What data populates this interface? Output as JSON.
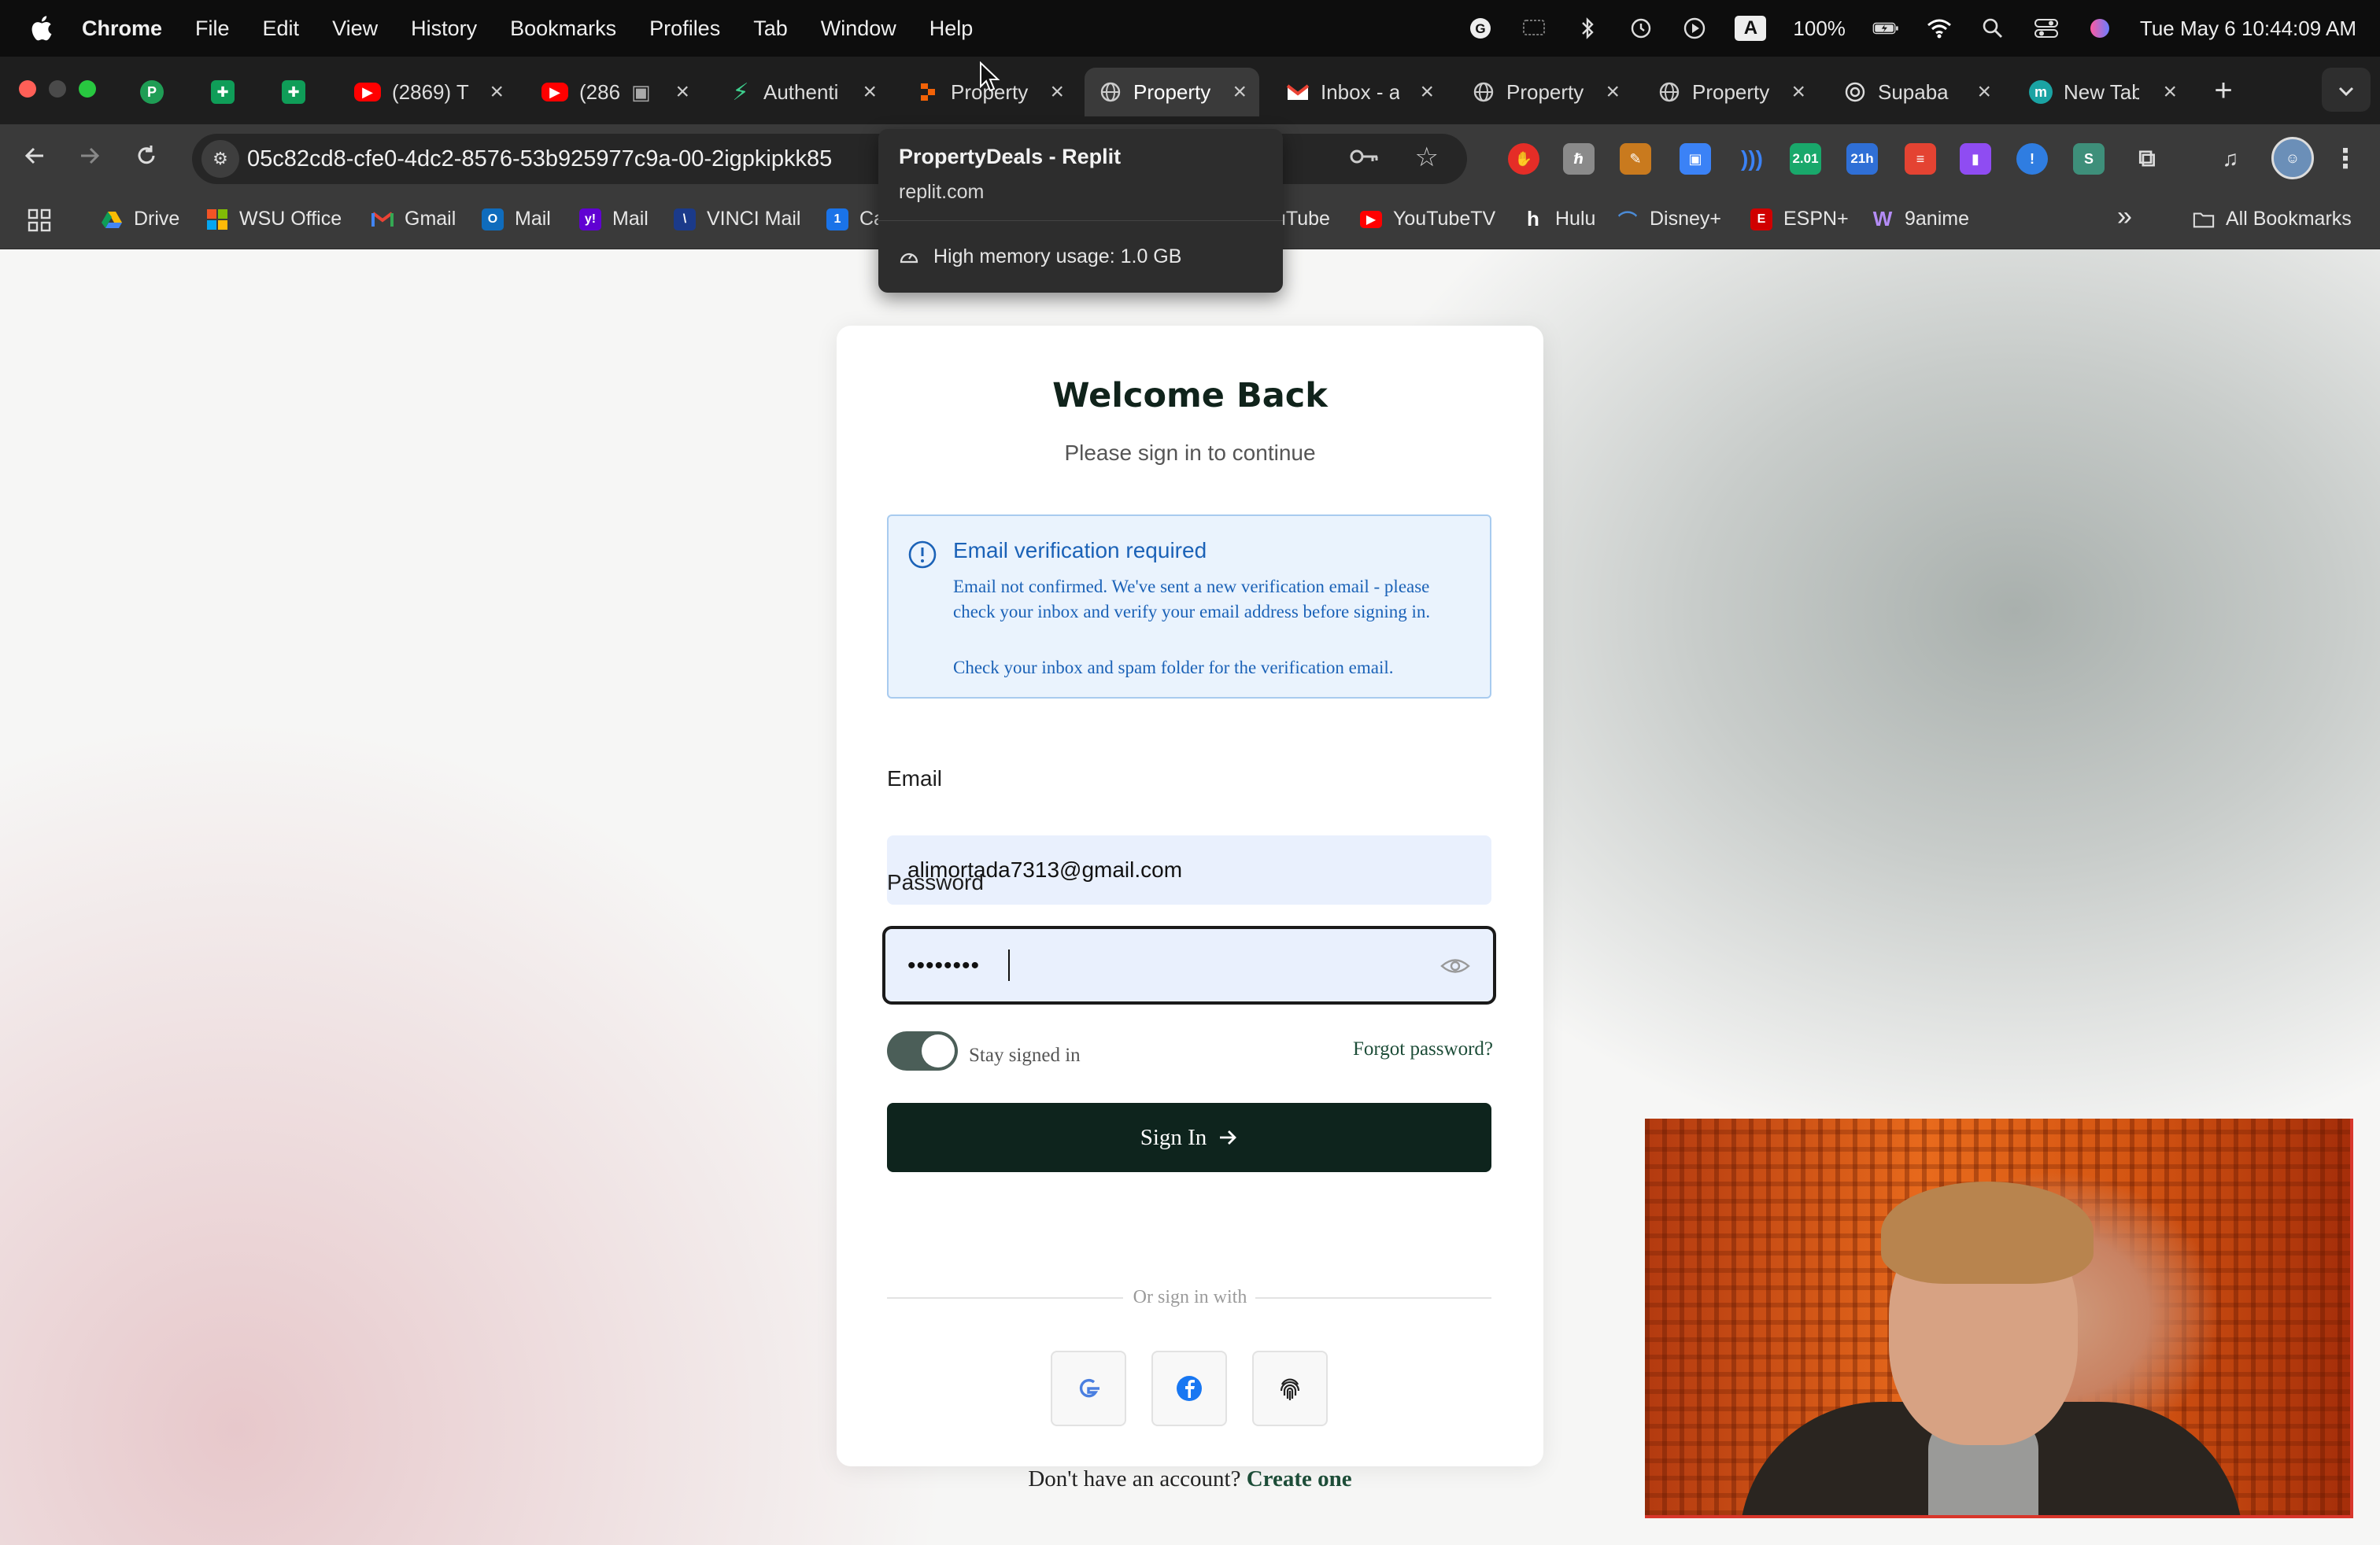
{
  "menubar": {
    "app": "Chrome",
    "menus": [
      "File",
      "Edit",
      "View",
      "History",
      "Bookmarks",
      "Profiles",
      "Tab",
      "Window",
      "Help"
    ],
    "battery": "100%",
    "datetime": "Tue May 6  10:44:09 AM",
    "input_source": "A"
  },
  "tabs": [
    {
      "title": "",
      "icon": "p-green-icon",
      "color": "#1f9d55"
    },
    {
      "title": "",
      "icon": "sheets-icon",
      "color": "#0f9d58"
    },
    {
      "title": "",
      "icon": "sheets-icon",
      "color": "#0f9d58"
    },
    {
      "title": "(2869) T",
      "icon": "youtube-icon",
      "color": "#ff0000"
    },
    {
      "title": "(286",
      "icon": "youtube-icon",
      "color": "#ff0000"
    },
    {
      "title": "Authenti",
      "icon": "supabase-icon",
      "color": "#3ecf8e"
    },
    {
      "title": "Property",
      "icon": "replit-icon",
      "color": "#f26207"
    },
    {
      "title": "Property",
      "icon": "globe-icon",
      "color": "#9aa0a6"
    },
    {
      "title": "Inbox - a",
      "icon": "gmail-icon",
      "color": "#ea4335"
    },
    {
      "title": "Property",
      "icon": "globe-icon",
      "color": "#9aa0a6"
    },
    {
      "title": "Property",
      "icon": "globe-icon",
      "color": "#9aa0a6"
    },
    {
      "title": "Supaba",
      "icon": "openai-icon",
      "color": "#dddddd"
    },
    {
      "title": "New Tab",
      "icon": "m-icon",
      "color": "#1aa3a3"
    }
  ],
  "address_bar": {
    "url": "05c82cd8-cfe0-4dc2-8576-53b925977c9a-00-2igpkipkk85"
  },
  "extensions": [
    {
      "icon": "hand-icon",
      "color": "#e52d27",
      "label": ""
    },
    {
      "icon": "ext-grey-icon",
      "color": "#8a8a8a",
      "label": ""
    },
    {
      "icon": "ext-orange-icon",
      "color": "#c97a1e",
      "label": ""
    },
    {
      "icon": "screen-icon",
      "color": "#3b82f6",
      "label": ""
    },
    {
      "icon": "audio-icon",
      "color": "#3b82f6",
      "label": ""
    },
    {
      "icon": "chart-ext-icon",
      "color": "#19a86b",
      "label": "2.01"
    },
    {
      "icon": "calendar-ext-icon",
      "color": "#2f6fd6",
      "label": "21h"
    },
    {
      "icon": "todoist-icon",
      "color": "#e44332",
      "label": ""
    },
    {
      "icon": "twitch-icon",
      "color": "#8f4cf2",
      "label": ""
    },
    {
      "icon": "info-ext-icon",
      "color": "#2f7de1",
      "label": ""
    },
    {
      "icon": "s-ext-icon",
      "color": "#3e8f7a",
      "label": ""
    }
  ],
  "bookmarks": [
    {
      "label": "Drive",
      "icon": "drive-icon",
      "color": "#fbbc04"
    },
    {
      "label": "WSU Office",
      "icon": "office-icon",
      "color": "#f35325"
    },
    {
      "label": "Gmail",
      "icon": "gmail-icon",
      "color": "#ea4335"
    },
    {
      "label": "Mail",
      "icon": "outlook-icon",
      "color": "#0f6cbd"
    },
    {
      "label": "Mail",
      "icon": "yahoo-icon",
      "color": "#6001d2"
    },
    {
      "label": "VINCI Mail",
      "icon": "vinci-icon",
      "color": "#1b3a8a"
    },
    {
      "label": "Ca",
      "icon": "calendar-icon",
      "color": "#1a73e8"
    },
    {
      "label": "uTube",
      "icon": "youtube-icon",
      "color": "#ff0000"
    },
    {
      "label": "YouTubeTV",
      "icon": "youtubetv-icon",
      "color": "#ff0000"
    },
    {
      "label": "Hulu",
      "icon": "hulu-icon",
      "color": "#1ce783"
    },
    {
      "label": "Disney+",
      "icon": "disney-icon",
      "color": "#4b8bd6"
    },
    {
      "label": "ESPN+",
      "icon": "espn-icon",
      "color": "#d00000"
    },
    {
      "label": "9anime",
      "icon": "9anime-icon",
      "color": "#8b5cf6"
    }
  ],
  "all_bookmarks": "All Bookmarks",
  "hover_card": {
    "title": "PropertyDeals - Replit",
    "domain": "replit.com",
    "memory": "High memory usage: 1.0 GB"
  },
  "login": {
    "title": "Welcome Back",
    "subtitle": "Please sign in to continue",
    "alert": {
      "heading": "Email verification required",
      "body": "Email not confirmed. We've sent a new verification email - please check your inbox and verify your email address before signing in.",
      "note": "Check your inbox and spam folder for the verification email."
    },
    "email_label": "Email",
    "email_value": "alimortada7313@gmail.com",
    "password_label": "Password",
    "password_mask": "••••••••",
    "stay_signed_in": "Stay signed in",
    "stay_signed_in_on": true,
    "forgot": "Forgot password?",
    "signin": "Sign In",
    "divider": "Or sign in with",
    "no_account": "Don't have an account?",
    "create": "Create one"
  },
  "colors": {
    "brand_dark": "#0e241d",
    "alert_blue": "#1b62b7",
    "link_green": "#1d4d38"
  }
}
